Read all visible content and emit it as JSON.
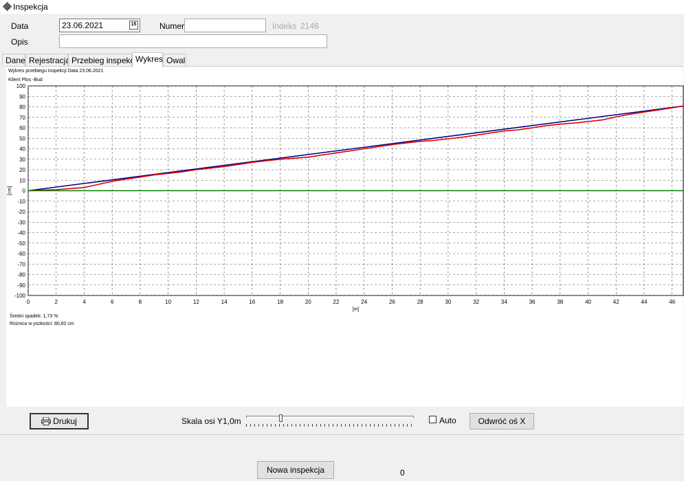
{
  "window": {
    "title": "Inspekcja",
    "icon": "gear-icon"
  },
  "header": {
    "data_label": "Data",
    "data_value": "23.06.2021",
    "numer_label": "Numer",
    "numer_value": "",
    "indeks_label": "Indeks",
    "indeks_value": "2146",
    "opis_label": "Opis",
    "opis_value": ""
  },
  "tabs": [
    {
      "label": "Dane",
      "active": false
    },
    {
      "label": "Rejestracja",
      "active": false
    },
    {
      "label": "Przebieg inspekcji",
      "active": false
    },
    {
      "label": "Wykres",
      "active": true
    },
    {
      "label": "Owal",
      "active": false
    }
  ],
  "chart_info": {
    "title": "Wykres przebiegu inspekcji  Data 23.06.2021",
    "subtitle": "Klient Plos -Bud",
    "avg_slope": "Średni spadek: 1,73 %",
    "height_diff": "Różnica w ysokości: 80,82 cm"
  },
  "chart_data": {
    "type": "line",
    "xlabel": "[m]",
    "ylabel": "[cm]",
    "xlim": [
      0,
      46.8
    ],
    "ylim": [
      -100,
      100
    ],
    "x_ticks": [
      0,
      2,
      4,
      6,
      8,
      10,
      12,
      14,
      16,
      18,
      20,
      22,
      24,
      26,
      28,
      30,
      32,
      34,
      36,
      38,
      40,
      42,
      44,
      46
    ],
    "y_ticks": [
      100,
      90,
      80,
      70,
      60,
      50,
      40,
      30,
      20,
      10,
      0,
      -10,
      -20,
      -30,
      -40,
      -50,
      -60,
      -70,
      -80,
      -90,
      -100
    ],
    "grid": true,
    "series": [
      {
        "color": "#00008b",
        "x": [
          0,
          46.8
        ],
        "y": [
          0,
          80.8
        ]
      },
      {
        "color": "#e00000",
        "x": [
          0,
          1,
          2,
          3,
          4,
          5,
          6,
          7,
          8,
          9,
          10,
          11,
          12,
          13,
          14,
          15,
          16,
          17,
          18,
          19,
          20,
          21,
          22,
          23,
          24,
          25,
          26,
          27,
          28,
          29,
          30,
          31,
          32,
          33,
          34,
          35,
          36,
          37,
          38,
          39,
          40,
          41,
          42,
          43,
          44,
          45,
          46,
          46.8
        ],
        "y": [
          0,
          0.5,
          1,
          2,
          3,
          6,
          9,
          11,
          13,
          15,
          16.5,
          18,
          20,
          21.5,
          23,
          25,
          27,
          28.5,
          30,
          31,
          32,
          34,
          36,
          38,
          40,
          42,
          44,
          45.5,
          47,
          48,
          49.5,
          51,
          53,
          55,
          57,
          58,
          60,
          62,
          63.5,
          64.5,
          66,
          67.5,
          70.5,
          73,
          75,
          77,
          79,
          80.8
        ]
      },
      {
        "color": "#008000",
        "x": [
          0,
          46.8
        ],
        "y": [
          0,
          0
        ]
      }
    ]
  },
  "controls": {
    "print_label": "Drukuj",
    "skala_label": "Skala osi Y",
    "skala_value": "1,0m",
    "skala_slider_fraction": 0.2,
    "auto_label": "Auto",
    "auto_checked": false,
    "flip_label": "Odwróć oś X"
  },
  "footer": {
    "new_inspection_label": "Nowa inspekcja",
    "counter": "0"
  }
}
